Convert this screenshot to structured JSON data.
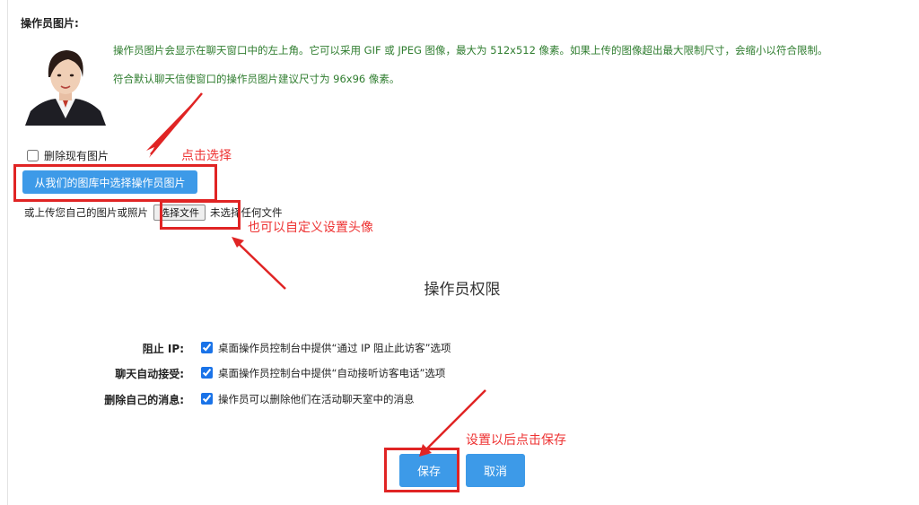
{
  "operator_picture": {
    "section_title": "操作员图片:",
    "description_line1": "操作员图片会显示在聊天窗口中的左上角。它可以采用 GIF 或 JPEG 图像，最大为 512x512 像素。如果上传的图像超出最大限制尺寸，会缩小以符合限制。",
    "description_line2": "符合默认聊天信使窗口的操作员图片建议尺寸为 96x96 像素。",
    "delete_checkbox_label": "删除现有图片",
    "delete_checked": false,
    "gallery_button_label": "从我们的图库中选择操作员图片",
    "upload_label": "或上传您自己的图片或照片",
    "file_button_label": "选择文件",
    "file_status": "未选择任何文件"
  },
  "permissions": {
    "title": "操作员权限",
    "items": [
      {
        "label": "阻止 IP:",
        "checked": true,
        "text": "桌面操作员控制台中提供“通过 IP 阻止此访客”选项"
      },
      {
        "label": "聊天自动接受:",
        "checked": true,
        "text": "桌面操作员控制台中提供“自动接听访客电话”选项"
      },
      {
        "label": "删除自己的消息:",
        "checked": true,
        "text": "操作员可以删除他们在活动聊天室中的消息"
      }
    ]
  },
  "actions": {
    "save_label": "保存",
    "cancel_label": "取消"
  },
  "annotations": {
    "click_select": "点击选择",
    "custom_avatar": "也可以自定义设置头像",
    "save_after": "设置以后点击保存"
  },
  "colors": {
    "button_blue": "#3d9ae8",
    "description_green": "#2f7d2f",
    "annotation_red": "#e02424"
  }
}
